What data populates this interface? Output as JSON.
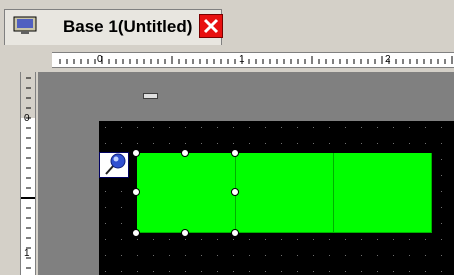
{
  "tab": {
    "title": "Base 1(Untitled)",
    "icon": "screen-icon",
    "close_icon": "close-icon"
  },
  "ruler_h": {
    "labels": [
      "0",
      "1",
      "2"
    ]
  },
  "ruler_v": {
    "labels": [
      "0",
      "1"
    ]
  },
  "canvas": {
    "parts_count": 3,
    "part_color": "#00ff00",
    "background": "#000000"
  },
  "colors": {
    "close_button": "#e81010",
    "workspace": "#808080",
    "chrome": "#d4d0c8"
  }
}
